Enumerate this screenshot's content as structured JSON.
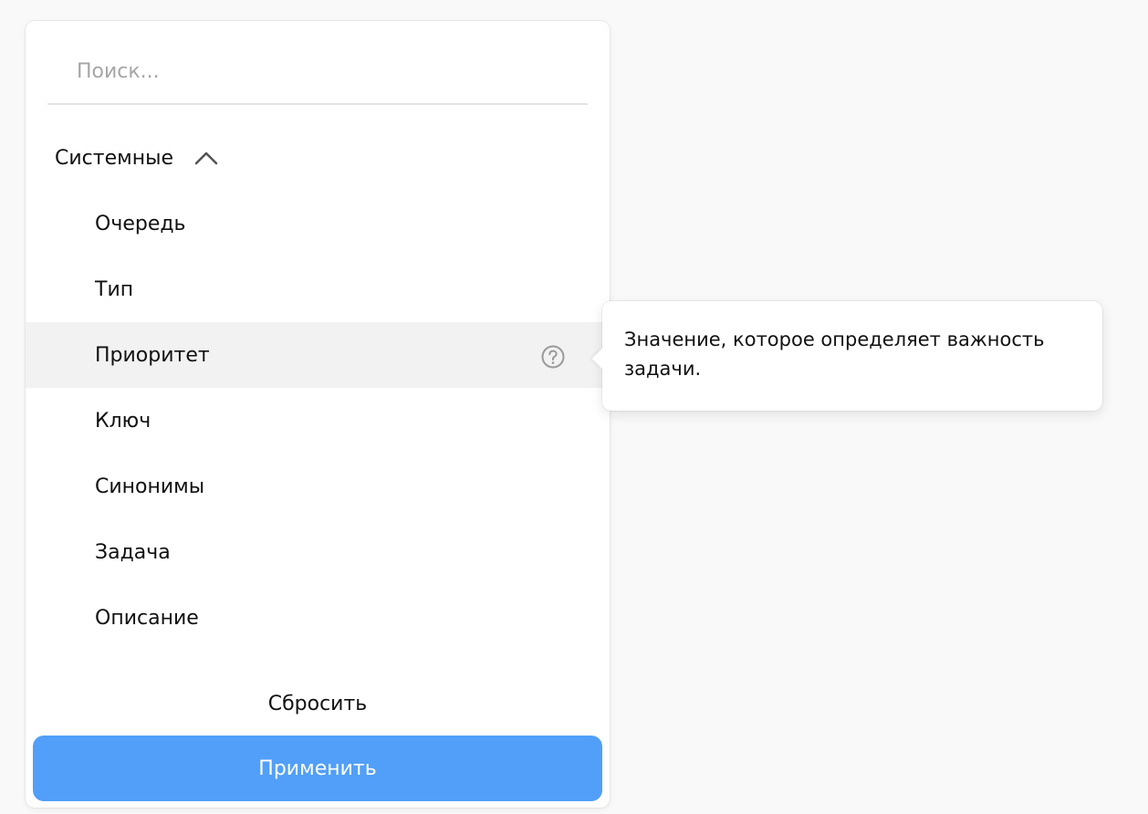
{
  "search": {
    "placeholder": "Поиск...",
    "value": ""
  },
  "group": {
    "label": "Системные",
    "expanded": true,
    "icon": "chevron-up-icon"
  },
  "fields": [
    {
      "label": "Очередь"
    },
    {
      "label": "Тип"
    },
    {
      "label": "Приоритет",
      "hovered": true,
      "icon": "help-icon"
    },
    {
      "label": "Ключ"
    },
    {
      "label": "Синонимы"
    },
    {
      "label": "Задача"
    },
    {
      "label": "Описание"
    }
  ],
  "actions": {
    "reset_label": "Сбросить",
    "apply_label": "Применить"
  },
  "tooltip": {
    "text": "Значение, которое определяет важность задачи."
  },
  "colors": {
    "accent": "#519ff8",
    "hover": "#f2f2f2",
    "background": "#f9f9f9"
  }
}
